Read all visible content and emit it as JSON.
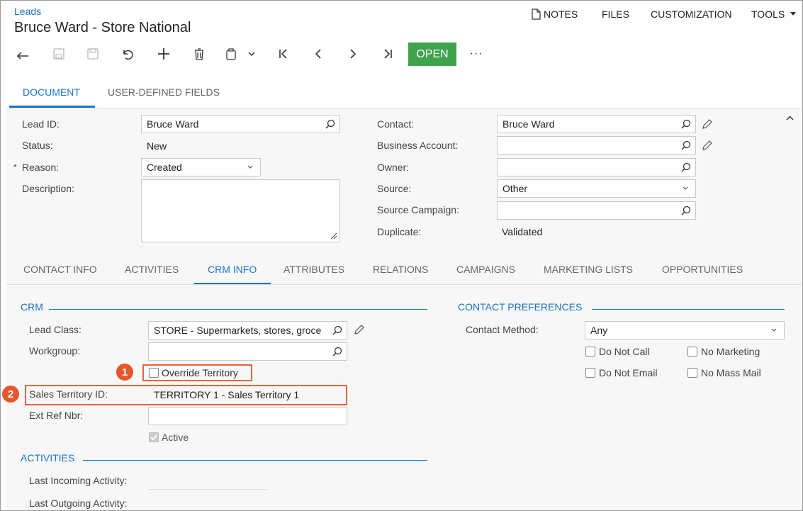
{
  "header": {
    "breadcrumb": "Leads",
    "title": "Bruce Ward - Store National",
    "menu": {
      "notes": "NOTES",
      "files": "FILES",
      "customization": "CUSTOMIZATION",
      "tools": "TOOLS"
    }
  },
  "toolbar": {
    "open_label": "OPEN",
    "more": "···"
  },
  "tabs": {
    "document": "DOCUMENT",
    "user_defined": "USER-DEFINED FIELDS"
  },
  "form": {
    "lead_id_label": "Lead ID:",
    "lead_id_value": "Bruce Ward",
    "status_label": "Status:",
    "status_value": "New",
    "reason_required": "*",
    "reason_label": "Reason:",
    "reason_value": "Created",
    "description_label": "Description:",
    "contact_label": "Contact:",
    "contact_value": "Bruce Ward",
    "business_account_label": "Business Account:",
    "owner_label": "Owner:",
    "source_label": "Source:",
    "source_value": "Other",
    "source_campaign_label": "Source Campaign:",
    "duplicate_label": "Duplicate:",
    "duplicate_value": "Validated"
  },
  "subtabs": [
    "CONTACT INFO",
    "ACTIVITIES",
    "CRM INFO",
    "ATTRIBUTES",
    "RELATIONS",
    "CAMPAIGNS",
    "MARKETING LISTS",
    "OPPORTUNITIES"
  ],
  "crm": {
    "section_title": "CRM",
    "lead_class_label": "Lead Class:",
    "lead_class_value": "STORE - Supermarkets, stores, groce",
    "workgroup_label": "Workgroup:",
    "override_territory_label": "Override Territory",
    "sales_territory_label": "Sales Territory ID:",
    "sales_territory_value": "TERRITORY 1 - Sales Territory 1",
    "ext_ref_label": "Ext Ref Nbr:",
    "active_label": "Active",
    "activities_title": "ACTIVITIES",
    "last_incoming_label": "Last Incoming Activity:",
    "last_outgoing_label": "Last Outgoing Activity:"
  },
  "contact_prefs": {
    "section_title": "CONTACT PREFERENCES",
    "contact_method_label": "Contact Method:",
    "contact_method_value": "Any",
    "do_not_call": "Do Not Call",
    "no_marketing": "No Marketing",
    "do_not_email": "Do Not Email",
    "no_mass_mail": "No Mass Mail"
  },
  "callouts": {
    "one": "1",
    "two": "2"
  },
  "colors": {
    "accent": "#1a73c9",
    "open_button": "#3fa34d",
    "callout": "#e8572b"
  }
}
